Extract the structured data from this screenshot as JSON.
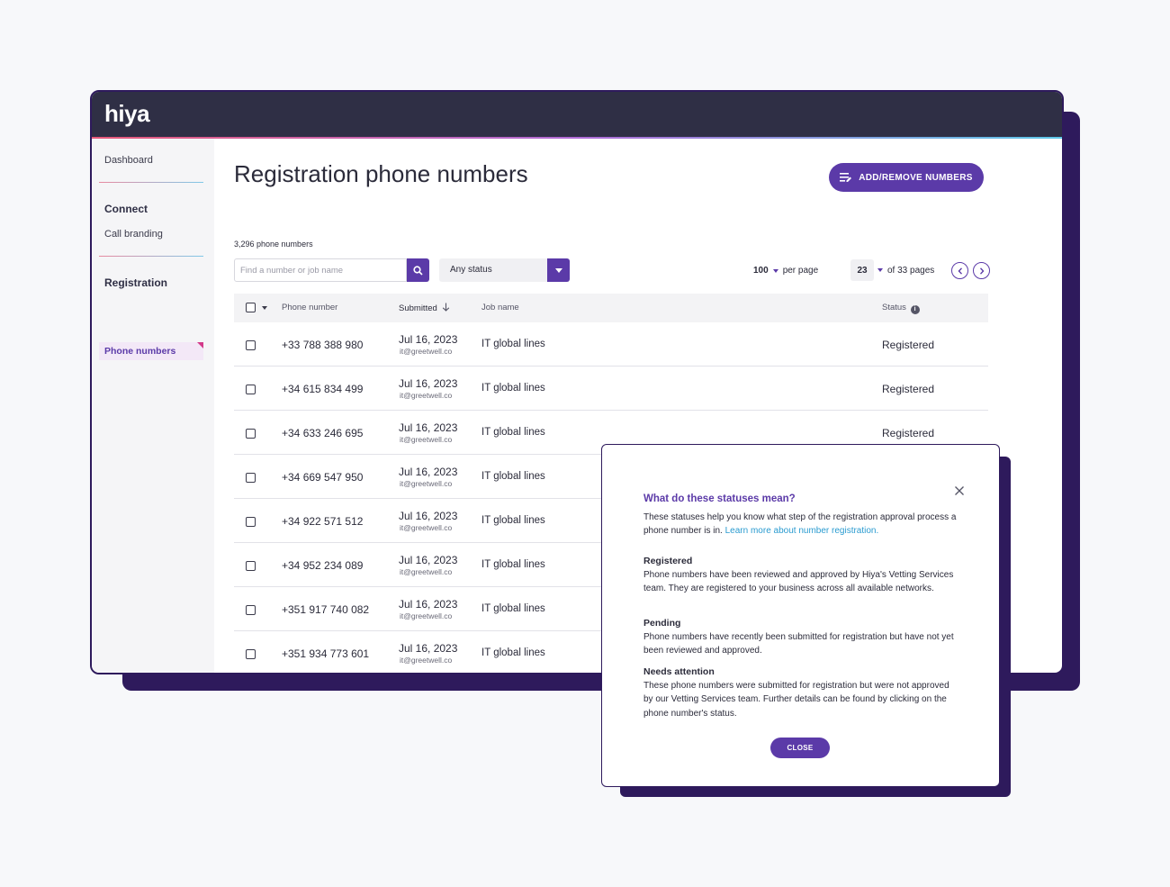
{
  "app": {
    "logo": "hiya"
  },
  "sidebar": {
    "dashboard": "Dashboard",
    "connect_heading": "Connect",
    "call_branding": "Call branding",
    "registration_heading": "Registration",
    "phone_numbers": "Phone numbers"
  },
  "main": {
    "title": "Registration phone numbers",
    "add_button": "ADD/REMOVE NUMBERS",
    "count": "3,296 phone numbers",
    "search_placeholder": "Find a number or job name",
    "status_filter": "Any status",
    "per_page_value": "100",
    "per_page_label": "per page",
    "page_current": "23",
    "page_total_label": "of 33 pages"
  },
  "table": {
    "headers": {
      "phone": "Phone number",
      "submitted": "Submitted",
      "job": "Job name",
      "status": "Status"
    },
    "rows": [
      {
        "phone": "+33 788 388 980",
        "date": "Jul 16, 2023",
        "email": "it@greetwell.co",
        "job": "IT global lines",
        "status": "Registered"
      },
      {
        "phone": "+34 615 834 499",
        "date": "Jul 16, 2023",
        "email": "it@greetwell.co",
        "job": "IT global lines",
        "status": "Registered"
      },
      {
        "phone": "+34 633 246 695",
        "date": "Jul 16, 2023",
        "email": "it@greetwell.co",
        "job": "IT global lines",
        "status": "Registered"
      },
      {
        "phone": "+34 669 547 950",
        "date": "Jul 16, 2023",
        "email": "it@greetwell.co",
        "job": "IT global lines",
        "status": ""
      },
      {
        "phone": "+34 922 571 512",
        "date": "Jul 16, 2023",
        "email": "it@greetwell.co",
        "job": "IT global lines",
        "status": ""
      },
      {
        "phone": "+34 952 234 089",
        "date": "Jul 16, 2023",
        "email": "it@greetwell.co",
        "job": "IT global lines",
        "status": ""
      },
      {
        "phone": "+351 917 740 082",
        "date": "Jul 16, 2023",
        "email": "it@greetwell.co",
        "job": "IT global lines",
        "status": ""
      },
      {
        "phone": "+351 934 773 601",
        "date": "Jul 16, 2023",
        "email": "it@greetwell.co",
        "job": "IT global lines",
        "status": ""
      }
    ]
  },
  "modal": {
    "title": "What do these statuses mean?",
    "intro": "These statuses help you know what step of the registration approval process a phone number is in.",
    "link": "Learn more about number registration.",
    "sections": [
      {
        "heading": "Registered",
        "body": "Phone numbers have been reviewed and approved by Hiya's Vetting Services team. They are registered to your business across all available networks."
      },
      {
        "heading": "Pending",
        "body": "Phone numbers have recently been submitted for registration but have not yet been reviewed and approved."
      },
      {
        "heading": "Needs attention",
        "body": "These phone numbers were submitted for registration but were not approved by our Vetting Services team. Further details can be found by clicking on the phone number's status."
      }
    ],
    "close_button": "CLOSE"
  },
  "colors": {
    "brand_purple": "#5b3aa8",
    "dark_navy": "#2f2f45",
    "shadow": "#2e1a5c",
    "link": "#2a9bd0"
  }
}
